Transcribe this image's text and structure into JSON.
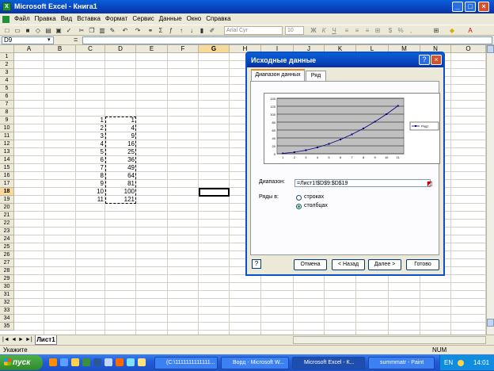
{
  "window": {
    "title": "Microsoft Excel - Книга1"
  },
  "menu": [
    "Файл",
    "Правка",
    "Вид",
    "Вставка",
    "Формат",
    "Сервис",
    "Данные",
    "Окно",
    "Справка"
  ],
  "toolbar": {
    "font_name": "Arial Cyr",
    "font_size": "10",
    "bold": "Ж",
    "italic": "К",
    "underline": "Ч"
  },
  "formula": {
    "name_box": "D9",
    "fx": "="
  },
  "columns": [
    "A",
    "B",
    "C",
    "D",
    "E",
    "F",
    "G",
    "H",
    "I",
    "J",
    "K",
    "L",
    "M",
    "N",
    "O"
  ],
  "rows": [
    "1",
    "2",
    "3",
    "4",
    "5",
    "6",
    "7",
    "8",
    "9",
    "10",
    "11",
    "12",
    "13",
    "14",
    "15",
    "16",
    "17",
    "18",
    "19",
    "20",
    "21",
    "22",
    "23",
    "24",
    "25",
    "26",
    "27",
    "28",
    "29",
    "30",
    "31",
    "32",
    "33",
    "34",
    "35"
  ],
  "colC": [
    "1",
    "2",
    "3",
    "4",
    "5",
    "6",
    "7",
    "8",
    "9",
    "10",
    "11"
  ],
  "colD": [
    "1",
    "4",
    "9",
    "16",
    "25",
    "36",
    "49",
    "64",
    "81",
    "100",
    "121"
  ],
  "sheet": {
    "tab": "Лист1"
  },
  "status": {
    "left": "Укажите",
    "num": "NUM"
  },
  "dialog": {
    "title": "Исходные данные",
    "help_btn": "?",
    "tabs": [
      "Диапазон данных",
      "Ряд"
    ],
    "range_label": "Диапазон:",
    "range_value": "=Лист1!$D$9:$D$19",
    "series_in_label": "Ряды в:",
    "option_rows": "строках",
    "option_cols": "столбцах",
    "buttons": {
      "cancel": "Отмена",
      "back": "< Назад",
      "next": "Далее >",
      "finish": "Готово"
    }
  },
  "chart_data": {
    "type": "line",
    "categories": [
      "1",
      "2",
      "3",
      "4",
      "5",
      "6",
      "7",
      "8",
      "9",
      "10",
      "11"
    ],
    "series": [
      {
        "name": "Ряд1",
        "values": [
          1,
          4,
          9,
          16,
          25,
          36,
          49,
          64,
          81,
          100,
          121
        ]
      }
    ],
    "ylim": [
      0,
      140
    ],
    "yticks": [
      "0",
      "20",
      "40",
      "60",
      "80",
      "100",
      "120",
      "140"
    ],
    "grid": true,
    "legend": "right"
  },
  "taskbar": {
    "start": "пуск",
    "tasks": [
      "(C:\\1111111111111...",
      "Ворд - Microsoft W...",
      "Microsoft Excel - К...",
      "summmatr - Paint"
    ],
    "lang": "EN",
    "clock": "14:01"
  }
}
